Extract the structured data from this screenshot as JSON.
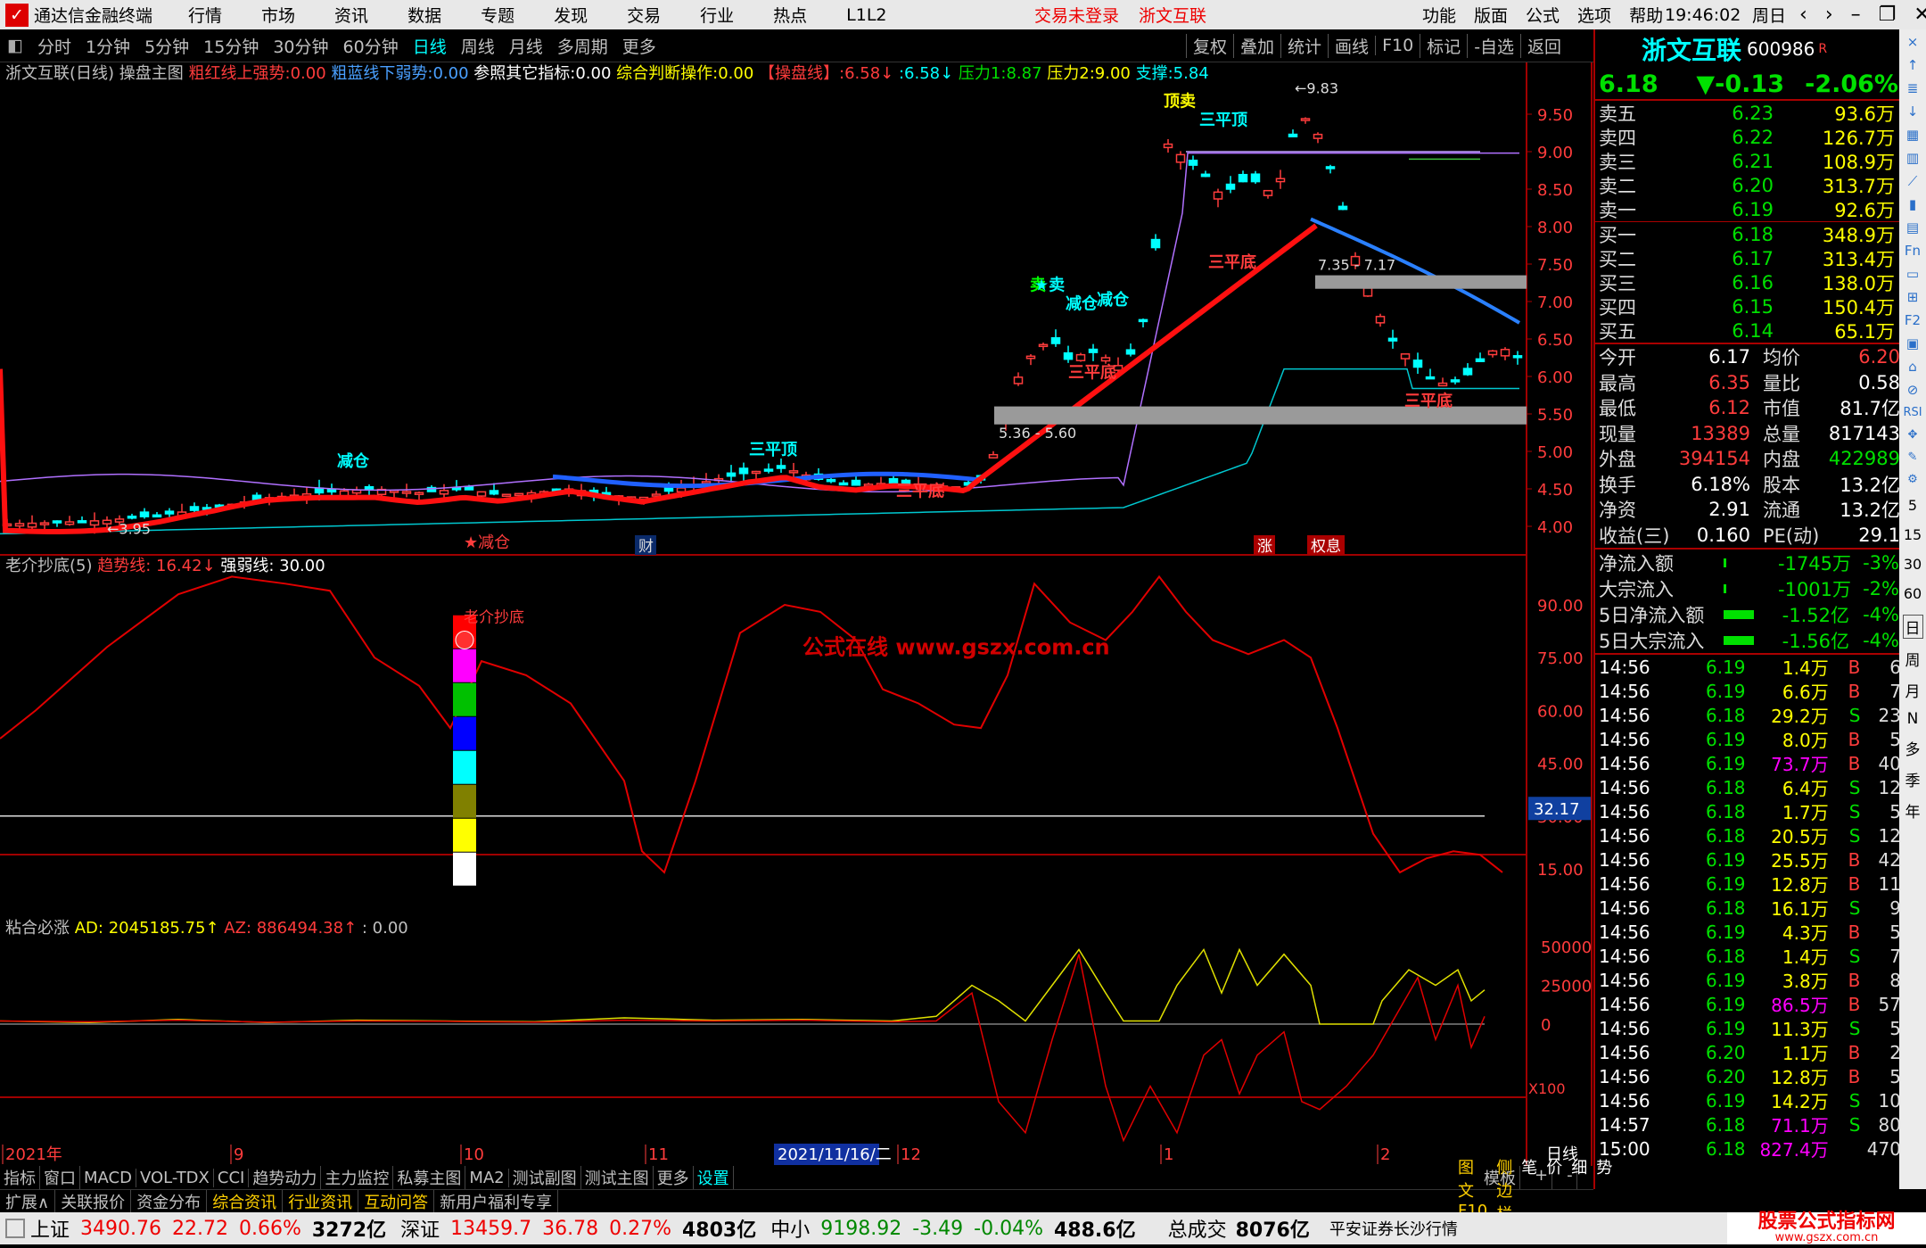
{
  "titlebar": {
    "app_name": "通达信金融终端",
    "menu": [
      "行情",
      "市场",
      "资讯",
      "数据",
      "专题",
      "发现",
      "交易",
      "行业",
      "热点",
      "L1L2"
    ],
    "center": [
      "交易未登录",
      "浙文互联"
    ],
    "right_menu": [
      "功能",
      "版面",
      "公式",
      "选项",
      "帮助"
    ],
    "clock": "19:46:02",
    "weekday": "周日"
  },
  "toolbar": {
    "periods": [
      "分时",
      "1分钟",
      "5分钟",
      "15分钟",
      "30分钟",
      "60分钟",
      "日线",
      "周线",
      "月线",
      "多周期",
      "更多"
    ],
    "active_period": "日线",
    "actions": [
      "复权",
      "叠加",
      "统计",
      "画线",
      "F10",
      "标记",
      "-自选",
      "返回"
    ]
  },
  "main_chart": {
    "header": {
      "stock": "浙文互联(日线)",
      "indicator": "操盘主图",
      "items": [
        {
          "label": "粗红线上强势:",
          "value": "0.00",
          "color": "#ff3c3c"
        },
        {
          "label": "粗蓝线下弱势:",
          "value": "0.00",
          "color": "#4aa0ff"
        },
        {
          "label": "参照其它指标:",
          "value": "0.00",
          "color": "#ffffff"
        },
        {
          "label": "综合判断操作:",
          "value": "0.00",
          "color": "#ffff00"
        },
        {
          "label": "【操盘线】:",
          "value": "6.58↓",
          "color": "#ff3c3c"
        },
        {
          "label": ":",
          "value": "6.58↓",
          "color": "#00ffff"
        },
        {
          "label": "压力1:",
          "value": "8.87",
          "color": "#00e000"
        },
        {
          "label": "压力2:",
          "value": "9.00",
          "color": "#ffff00"
        },
        {
          "label": "支撑:",
          "value": "5.84",
          "color": "#00ffff"
        }
      ]
    },
    "y_ticks": [
      "9.50",
      "9.00",
      "8.50",
      "8.00",
      "7.50",
      "7.00",
      "6.50",
      "6.00",
      "5.50",
      "5.00",
      "4.50",
      "4.00"
    ],
    "annotations": {
      "high": "9.83",
      "low": "3.95",
      "box1": "7.35 - 7.17",
      "box2": "5.36 - 5.60",
      "signals": [
        "顶卖",
        "三平顶",
        "三平底",
        "减仓",
        "卖",
        "三平底",
        "三平底",
        "三平底",
        "减仓",
        "减仓",
        "三平顶",
        "★卖"
      ],
      "markers": [
        "财",
        "涨",
        "权息"
      ]
    }
  },
  "sub1": {
    "title": "老介抄底(5)",
    "items": [
      {
        "label": "趋势线:",
        "value": "16.42↓",
        "color": "#ff3c3c"
      },
      {
        "label": "强弱线:",
        "value": "30.00",
        "color": "#ffffff"
      }
    ],
    "watermark": "公式在线  www.gszx.com.cn",
    "label": "老介抄底",
    "y_ticks": [
      "90.00",
      "75.00",
      "60.00",
      "45.00",
      "30.00",
      "15.00"
    ],
    "current": "32.17"
  },
  "sub2": {
    "title": "粘合必涨",
    "items": [
      {
        "label": "AD:",
        "value": "2045185.75↑",
        "color": "#ffff00"
      },
      {
        "label": "AZ:",
        "value": "886494.38↑",
        "color": "#ff3c3c"
      },
      {
        "label": ":",
        "value": "0.00",
        "color": "#c0c0c0"
      }
    ],
    "y_ticks": [
      "50000",
      "25000",
      "0"
    ],
    "scale": "X100"
  },
  "x_axis": {
    "labels": [
      "2021年",
      "9",
      "10",
      "11",
      "2021/11/16/二",
      "12",
      "1",
      "2"
    ],
    "period": "日线"
  },
  "bottom_tabs": [
    "指标",
    "窗口",
    "MACD",
    "VOL-TDX",
    "CCI",
    "趋势动力",
    "主力监控",
    "私募主图",
    "MA2",
    "测试副图",
    "测试主图",
    "更多",
    "设置"
  ],
  "bottom_tabs_right": [
    "模板",
    "+",
    "-"
  ],
  "bottom_bar2": [
    "扩展∧",
    "关联报价",
    "资金分布",
    "综合资讯",
    "行业资讯",
    "互动问答",
    "新用户福利专享"
  ],
  "bottom_bar2_right": [
    "图文F10",
    "侧边栏《",
    "笔",
    "价",
    "细",
    "势"
  ],
  "quote": {
    "name": "浙文互联",
    "code": "600986",
    "tag": "R",
    "price": "6.18",
    "change": "▼-0.13",
    "pct": "-2.06%",
    "asks": [
      {
        "label": "卖五",
        "price": "6.23",
        "vol": "93.6万"
      },
      {
        "label": "卖四",
        "price": "6.22",
        "vol": "126.7万"
      },
      {
        "label": "卖三",
        "price": "6.21",
        "vol": "108.9万"
      },
      {
        "label": "卖二",
        "price": "6.20",
        "vol": "313.7万"
      },
      {
        "label": "卖一",
        "price": "6.19",
        "vol": "92.6万"
      }
    ],
    "bids": [
      {
        "label": "买一",
        "price": "6.18",
        "vol": "348.9万"
      },
      {
        "label": "买二",
        "price": "6.17",
        "vol": "313.4万"
      },
      {
        "label": "买三",
        "price": "6.16",
        "vol": "138.0万"
      },
      {
        "label": "买四",
        "price": "6.15",
        "vol": "150.4万"
      },
      {
        "label": "买五",
        "price": "6.14",
        "vol": "65.1万"
      }
    ],
    "stats": [
      [
        "今开",
        "6.17",
        "均价",
        "6.20"
      ],
      [
        "最高",
        "6.35",
        "量比",
        "0.58"
      ],
      [
        "最低",
        "6.12",
        "市值",
        "81.7亿"
      ],
      [
        "现量",
        "13389",
        "总量",
        "817143"
      ],
      [
        "外盘",
        "394154",
        "内盘",
        "422989"
      ],
      [
        "换手",
        "6.18%",
        "股本",
        "13.2亿"
      ],
      [
        "净资",
        "2.91",
        "流通",
        "13.2亿"
      ],
      [
        "收益(三)",
        "0.160",
        "PE(动)",
        "29.1"
      ]
    ],
    "flows": [
      [
        "净流入额",
        "-1745万",
        "-3%"
      ],
      [
        "大宗流入",
        "-1001万",
        "-2%"
      ],
      [
        "5日净流入额",
        "-1.52亿",
        "-4%"
      ],
      [
        "5日大宗流入",
        "-1.56亿",
        "-4%"
      ]
    ],
    "ticks": [
      [
        "14:56",
        "6.19",
        "1.4万",
        "B",
        "6"
      ],
      [
        "14:56",
        "6.19",
        "6.6万",
        "B",
        "7"
      ],
      [
        "14:56",
        "6.18",
        "29.2万",
        "S",
        "23"
      ],
      [
        "14:56",
        "6.19",
        "8.0万",
        "B",
        "5"
      ],
      [
        "14:56",
        "6.19",
        "73.7万",
        "B",
        "40"
      ],
      [
        "14:56",
        "6.18",
        "6.4万",
        "S",
        "12"
      ],
      [
        "14:56",
        "6.18",
        "1.7万",
        "S",
        "5"
      ],
      [
        "14:56",
        "6.18",
        "20.5万",
        "S",
        "12"
      ],
      [
        "14:56",
        "6.19",
        "25.5万",
        "B",
        "42"
      ],
      [
        "14:56",
        "6.19",
        "12.8万",
        "B",
        "11"
      ],
      [
        "14:56",
        "6.18",
        "16.1万",
        "S",
        "9"
      ],
      [
        "14:56",
        "6.19",
        "4.3万",
        "B",
        "5"
      ],
      [
        "14:56",
        "6.18",
        "1.4万",
        "S",
        "7"
      ],
      [
        "14:56",
        "6.19",
        "3.8万",
        "B",
        "8"
      ],
      [
        "14:56",
        "6.19",
        "86.5万",
        "B",
        "57"
      ],
      [
        "14:56",
        "6.19",
        "11.3万",
        "S",
        "5"
      ],
      [
        "14:56",
        "6.20",
        "1.1万",
        "B",
        "2"
      ],
      [
        "14:56",
        "6.20",
        "12.8万",
        "B",
        "5"
      ],
      [
        "14:56",
        "6.19",
        "14.2万",
        "S",
        "10"
      ],
      [
        "14:57",
        "6.18",
        "71.1万",
        "S",
        "80"
      ],
      [
        "15:00",
        "6.18",
        "827.4万",
        "",
        "470"
      ]
    ]
  },
  "vtoolbar": [
    "日",
    "周",
    "月",
    "N",
    "多",
    "季",
    "年"
  ],
  "vtoolbar_nums": [
    "5",
    "15",
    "30",
    "60"
  ],
  "statusbar": {
    "items": [
      {
        "name": "上证",
        "value": "3490.76",
        "chg": "22.72",
        "pct": "0.66%",
        "amt": "3272亿"
      },
      {
        "name": "深证",
        "value": "13459.7",
        "chg": "36.78",
        "pct": "0.27%",
        "amt": "4803亿"
      },
      {
        "name": "中小",
        "value": "9198.92",
        "chg": "-3.49",
        "pct": "-0.04%",
        "amt": "488.6亿"
      }
    ],
    "total_label": "总成交",
    "total": "8076亿",
    "broker": "平安证券长沙行情",
    "logo_text": "股票公式指标网",
    "logo_url": "www.gszx.com.cn"
  },
  "colors": {
    "up": "#ff3c3c",
    "down": "#00ffff",
    "bg": "#000000",
    "border": "#a00000"
  }
}
